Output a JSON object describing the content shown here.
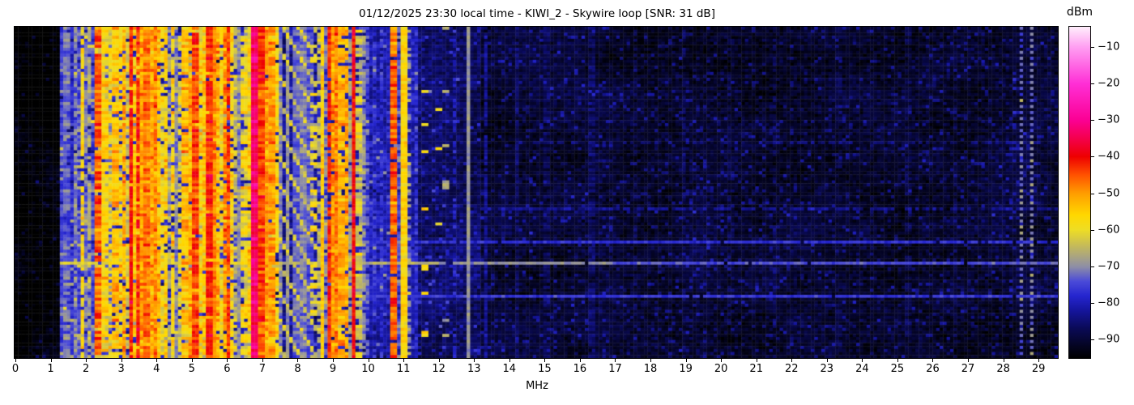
{
  "title": "01/12/2025 23:30 local time - KIWI_2 - Skywire loop [SNR: 31 dB]",
  "axis": {
    "xlabel": "MHz",
    "x_ticks": [
      0,
      1,
      2,
      3,
      4,
      5,
      6,
      7,
      8,
      9,
      10,
      11,
      12,
      13,
      14,
      15,
      16,
      17,
      18,
      19,
      20,
      21,
      22,
      23,
      24,
      25,
      26,
      27,
      28,
      29
    ],
    "x_max": 29.57
  },
  "colorbar": {
    "label": "dBm",
    "tick_values": [
      -10,
      -20,
      -30,
      -40,
      -50,
      -60,
      -70,
      -80,
      -90
    ],
    "tick_labels": [
      "−10",
      "−20",
      "−30",
      "−40",
      "−50",
      "−60",
      "−70",
      "−80",
      "−90"
    ],
    "vmax": -4.5,
    "vmin": -95
  },
  "chart_data": {
    "type": "heatmap",
    "title": "01/12/2025 23:30 local time - KIWI_2 - Skywire loop [SNR: 31 dB]",
    "xlabel": "MHz",
    "ylabel": "",
    "x_range": [
      0,
      29.57
    ],
    "value_label": "dBm",
    "value_range": [
      -95,
      -4.5
    ],
    "legend_position": "right-colorbar",
    "grid": false,
    "colormap_stops": [
      [
        -95,
        "#000000"
      ],
      [
        -92,
        "#04041e"
      ],
      [
        -87,
        "#0a0a55"
      ],
      [
        -82,
        "#15159c"
      ],
      [
        -78,
        "#2525cf"
      ],
      [
        -74,
        "#4b4bd8"
      ],
      [
        -70,
        "#8f8fa5"
      ],
      [
        -64,
        "#c8bd55"
      ],
      [
        -60,
        "#eedd25"
      ],
      [
        -56,
        "#ffd800"
      ],
      [
        -50,
        "#ff9d00"
      ],
      [
        -45,
        "#ff5200"
      ],
      [
        -40,
        "#ee0000"
      ],
      [
        -36,
        "#f3003e"
      ],
      [
        -30,
        "#fb0094"
      ],
      [
        -20,
        "#ff2fd6"
      ],
      [
        -10,
        "#ff9ff2"
      ],
      [
        -4.5,
        "#ffeffc"
      ]
    ],
    "noise_floor_regions_fields": "f_start,f_end,level_dbm,sigma,speckle_prob,speckle_boost",
    "noise_floor_regions": [
      [
        0.0,
        1.25,
        -94.5,
        2.0,
        0.04,
        5
      ],
      [
        1.25,
        7.42,
        -79,
        4.0,
        0.06,
        12
      ],
      [
        7.42,
        8.58,
        -83,
        3.5,
        0.05,
        8
      ],
      [
        8.58,
        11.4,
        -80.5,
        3.5,
        0.05,
        8
      ],
      [
        11.4,
        13.2,
        -86,
        3.0,
        0.07,
        7
      ],
      [
        13.2,
        29.57,
        -90.5,
        2.5,
        0.1,
        6
      ]
    ],
    "signal_stripes_fields": "f_mhz,width_mhz,level_dbm,sigma,duty,row_start_frac,row_end_frac",
    "signal_stripes": [
      [
        1.32,
        0.05,
        -75,
        4,
        0.9
      ],
      [
        1.42,
        0.06,
        -72,
        4,
        0.9
      ],
      [
        1.56,
        0.05,
        -77,
        4,
        0.85
      ],
      [
        1.66,
        0.06,
        -71,
        5,
        0.9
      ],
      [
        1.78,
        0.05,
        -74,
        4,
        0.8
      ],
      [
        1.88,
        0.05,
        -57,
        5,
        0.9
      ],
      [
        1.97,
        0.05,
        -71,
        4,
        0.85
      ],
      [
        2.07,
        0.05,
        -67,
        5,
        0.8
      ],
      [
        2.16,
        0.04,
        -74,
        4,
        0.8
      ],
      [
        2.25,
        0.04,
        -64,
        6,
        0.7
      ],
      [
        2.34,
        0.05,
        -46,
        6,
        0.9
      ],
      [
        2.43,
        0.04,
        -61,
        5,
        0.8
      ],
      [
        2.52,
        0.06,
        -57,
        6,
        0.85
      ],
      [
        2.6,
        0.04,
        -71,
        5,
        0.9
      ],
      [
        2.68,
        0.05,
        -59,
        6,
        0.75
      ],
      [
        2.78,
        0.06,
        -54,
        6,
        0.9
      ],
      [
        2.88,
        0.04,
        -67,
        5,
        0.8
      ],
      [
        2.97,
        0.05,
        -57,
        6,
        0.75
      ],
      [
        3.06,
        0.06,
        -52,
        6,
        0.9
      ],
      [
        3.15,
        0.04,
        -63,
        5,
        0.8
      ],
      [
        3.24,
        0.035,
        -41,
        4,
        0.95
      ],
      [
        3.33,
        0.06,
        -54,
        6,
        0.9
      ],
      [
        3.43,
        0.035,
        -43,
        5,
        0.9
      ],
      [
        3.52,
        0.06,
        -55,
        5,
        0.9
      ],
      [
        3.62,
        0.1,
        -51,
        5,
        1
      ],
      [
        3.74,
        0.09,
        -48,
        5,
        1
      ],
      [
        3.85,
        0.07,
        -51,
        5,
        1
      ],
      [
        3.94,
        0.06,
        -49,
        5,
        1
      ],
      [
        4.04,
        0.05,
        -54,
        5,
        0.95
      ],
      [
        4.13,
        0.05,
        -59,
        5,
        0.85
      ],
      [
        4.23,
        0.05,
        -56,
        5,
        0.9
      ],
      [
        4.34,
        0.04,
        -67,
        5,
        0.8
      ],
      [
        4.45,
        0.05,
        -57,
        6,
        0.85
      ],
      [
        4.56,
        0.04,
        -70,
        4,
        0.95
      ],
      [
        4.66,
        0.04,
        -61,
        5,
        0.75
      ],
      [
        4.77,
        0.05,
        -54,
        6,
        0.85
      ],
      [
        4.88,
        0.04,
        -65,
        5,
        0.8
      ],
      [
        4.98,
        0.05,
        -51,
        6,
        0.9
      ],
      [
        5.07,
        0.035,
        -44,
        5,
        0.9
      ],
      [
        5.17,
        0.05,
        -57,
        6,
        0.8
      ],
      [
        5.28,
        0.05,
        -61,
        5,
        0.8
      ],
      [
        5.38,
        0.04,
        -54,
        5,
        0.85
      ],
      [
        5.46,
        0.04,
        -42,
        5,
        0.95
      ],
      [
        5.56,
        0.08,
        -49,
        5,
        1
      ],
      [
        5.69,
        0.06,
        -53,
        5,
        0.95
      ],
      [
        5.79,
        0.04,
        -59,
        5,
        0.85
      ],
      [
        5.91,
        0.07,
        -49,
        6,
        0.95
      ],
      [
        6.01,
        0.04,
        -44,
        5,
        0.9
      ],
      [
        6.11,
        0.05,
        -57,
        5,
        0.85
      ],
      [
        6.23,
        0.04,
        -65,
        5,
        0.8
      ],
      [
        6.33,
        0.04,
        -70,
        4,
        1
      ],
      [
        6.44,
        0.05,
        -59,
        6,
        0.75
      ],
      [
        6.56,
        0.05,
        -63,
        5,
        0.8
      ],
      [
        6.67,
        0.04,
        -55,
        6,
        0.75
      ],
      [
        6.76,
        0.04,
        -33,
        4,
        1
      ],
      [
        6.86,
        0.04,
        -54,
        5,
        0.85
      ],
      [
        6.94,
        0.05,
        -44,
        5,
        1
      ],
      [
        7.04,
        0.06,
        -51,
        5,
        0.95
      ],
      [
        7.13,
        0.05,
        -55,
        5,
        0.9
      ],
      [
        7.23,
        0.06,
        -50,
        5,
        0.95
      ],
      [
        7.33,
        0.04,
        -57,
        5,
        0.85
      ],
      [
        7.52,
        0.03,
        -72,
        3,
        1
      ],
      [
        7.72,
        0.03,
        -70,
        3,
        1
      ],
      [
        7.92,
        0.03,
        -73,
        3,
        1
      ],
      [
        8.12,
        0.03,
        -71,
        3,
        1
      ],
      [
        8.32,
        0.03,
        -74,
        3,
        1
      ],
      [
        8.45,
        0.05,
        -60,
        6,
        0.3
      ],
      [
        8.62,
        0.04,
        -66,
        5,
        0.75
      ],
      [
        8.7,
        0.04,
        -55,
        5,
        0.95
      ],
      [
        8.8,
        0.03,
        -70,
        4,
        0.8
      ],
      [
        8.86,
        0.03,
        -42,
        4,
        0.9
      ],
      [
        8.96,
        0.05,
        -50,
        5,
        0.95
      ],
      [
        9.05,
        0.05,
        -48,
        5,
        1
      ],
      [
        9.14,
        0.04,
        -58,
        5,
        0.8
      ],
      [
        9.22,
        0.04,
        -52,
        5,
        0.9
      ],
      [
        9.35,
        0.05,
        -52,
        5,
        0.85
      ],
      [
        9.45,
        0.03,
        -67,
        4,
        0.8
      ],
      [
        9.58,
        0.035,
        -40,
        4,
        1
      ],
      [
        9.7,
        0.04,
        -63,
        5,
        0.75
      ],
      [
        9.82,
        0.04,
        -70,
        4,
        0.8
      ],
      [
        9.97,
        0.04,
        -74,
        4,
        0.7
      ],
      [
        10.17,
        0.04,
        -77,
        4,
        0.65
      ],
      [
        10.37,
        0.04,
        -76,
        4,
        0.6
      ],
      [
        10.55,
        0.04,
        -79,
        4,
        0.6
      ],
      [
        10.68,
        0.04,
        -47,
        5,
        0.95
      ],
      [
        10.82,
        0.03,
        -74,
        4,
        0.7
      ],
      [
        10.98,
        0.035,
        -56,
        3,
        1
      ],
      [
        11.07,
        0.03,
        -75,
        4,
        0.8
      ],
      [
        11.17,
        0.03,
        -69,
        5,
        0.5
      ],
      [
        11.32,
        0.03,
        -77,
        4,
        0.6
      ],
      [
        11.58,
        0.05,
        -57,
        3,
        0.08
      ],
      [
        11.78,
        0.04,
        -60,
        3,
        0.05
      ],
      [
        11.97,
        0.04,
        -58,
        3,
        0.05
      ],
      [
        12.18,
        0.04,
        -66,
        3,
        0.06
      ],
      [
        12.4,
        0.03,
        -80,
        4,
        0.5
      ],
      [
        12.78,
        0.025,
        -69,
        1.5,
        1
      ],
      [
        13.32,
        0.04,
        -83,
        2,
        0.9
      ],
      [
        14.2,
        0.04,
        -86,
        2,
        0.7
      ],
      [
        15.05,
        0.04,
        -87,
        2,
        0.6
      ],
      [
        16.3,
        0.04,
        -86,
        2,
        0.7
      ],
      [
        17.55,
        0.04,
        -87,
        2,
        0.5
      ],
      [
        18.9,
        0.04,
        -86.5,
        2,
        0.6
      ],
      [
        20.2,
        0.04,
        -87,
        2,
        0.5
      ],
      [
        21.5,
        0.04,
        -87,
        2,
        0.5
      ],
      [
        23.3,
        0.04,
        -87.5,
        2,
        0.4
      ],
      [
        25.3,
        0.04,
        -87.5,
        2,
        0.4
      ],
      [
        26.6,
        0.04,
        -88,
        2,
        0.4
      ],
      [
        28.26,
        0.04,
        -80,
        2,
        0.35,
        0.12,
        0.4
      ]
    ],
    "dotted_columns": {
      "freqs": [
        28.52,
        28.74
      ],
      "level": -71,
      "sigma": 4,
      "row_period": 2
    },
    "diagonal_pattern": {
      "f_start": 7.45,
      "f_end": 8.55,
      "level": -63,
      "sigma": 5,
      "col_mult": 2,
      "row_mult": -1,
      "period": 9,
      "width": 2
    },
    "horizontal_lines_fields": "row_frac,[f_start,f_end,level_dbm,duty]",
    "horizontal_lines": [
      [
        0.342,
        [
          [
            14,
            29.57,
            -85,
            0.55
          ]
        ]
      ],
      [
        0.545,
        [
          [
            13,
            29.57,
            -83,
            0.7
          ]
        ]
      ],
      [
        0.642,
        [
          [
            7.45,
            29.57,
            -77,
            0.95
          ]
        ]
      ],
      [
        0.705,
        [
          [
            1.25,
            7.4,
            -62,
            0.9
          ],
          [
            7.4,
            12,
            -66,
            0.95
          ],
          [
            12,
            17,
            -70,
            0.95
          ],
          [
            17,
            29.57,
            -74,
            0.95
          ]
        ]
      ],
      [
        0.81,
        [
          [
            7.45,
            29.57,
            -76,
            0.95
          ]
        ]
      ]
    ],
    "render": {
      "bins": 300,
      "rows": 110,
      "seed": 1337,
      "cloud_amp": 2.6
    }
  }
}
